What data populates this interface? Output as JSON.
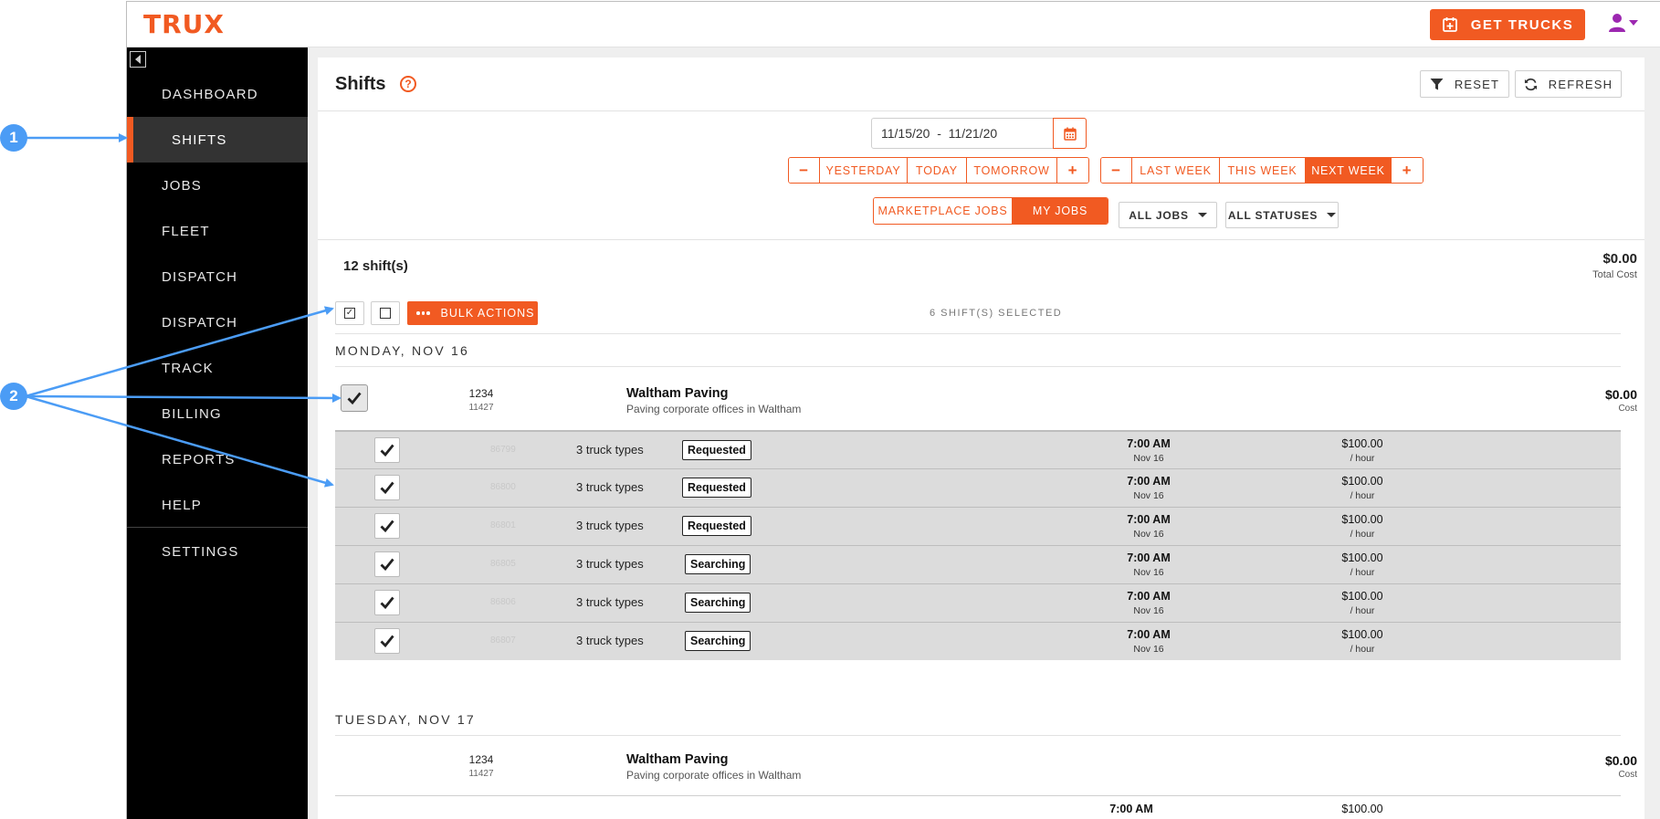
{
  "app": {
    "logo": "TRUX",
    "get_trucks_label": "GET TRUCKS"
  },
  "sidebar": {
    "items": [
      {
        "label": "DASHBOARD",
        "active": false
      },
      {
        "label": "SHIFTS",
        "active": true
      },
      {
        "label": "JOBS",
        "active": false
      },
      {
        "label": "FLEET",
        "active": false
      },
      {
        "label": "DISPATCH",
        "active": false
      },
      {
        "label": "DISPATCH",
        "active": false
      },
      {
        "label": "TRACK",
        "active": false
      },
      {
        "label": "BILLING",
        "active": false
      },
      {
        "label": "REPORTS",
        "active": false
      },
      {
        "label": "HELP",
        "active": false
      },
      {
        "label": "SETTINGS",
        "active": false
      }
    ]
  },
  "page": {
    "title": "Shifts",
    "reset_label": "RESET",
    "refresh_label": "REFRESH"
  },
  "date_filter": {
    "range": "11/15/20  -  11/21/20",
    "day_buttons": [
      "−",
      "YESTERDAY",
      "TODAY",
      "TOMORROW",
      "+"
    ],
    "week_buttons": [
      "−",
      "LAST WEEK",
      "THIS WEEK",
      "NEXT WEEK",
      "+"
    ],
    "selected_week": "NEXT WEEK"
  },
  "job_source": {
    "options": [
      "MARKETPLACE JOBS",
      "MY JOBS"
    ],
    "selected": "MY JOBS"
  },
  "filters": {
    "jobs": "ALL JOBS",
    "statuses": "ALL STATUSES"
  },
  "summary": {
    "shift_count": "12 shift(s)",
    "total_cost": "$0.00",
    "total_cost_label": "Total Cost"
  },
  "bulk": {
    "label": "BULK ACTIONS",
    "selected_text": "6 SHIFT(S) SELECTED"
  },
  "days": [
    {
      "heading": "MONDAY, NOV 16",
      "job": {
        "id": "1234",
        "sub_id": "11427",
        "name": "Waltham Paving",
        "description": "Paving corporate offices in Waltham",
        "cost": "$0.00",
        "cost_label": "Cost"
      },
      "shifts": [
        {
          "id": "86799",
          "trucks": "3 truck types",
          "status": "Requested",
          "time": "7:00 AM",
          "date": "Nov 16",
          "rate": "$100.00",
          "per": "/ hour"
        },
        {
          "id": "86800",
          "trucks": "3 truck types",
          "status": "Requested",
          "time": "7:00 AM",
          "date": "Nov 16",
          "rate": "$100.00",
          "per": "/ hour"
        },
        {
          "id": "86801",
          "trucks": "3 truck types",
          "status": "Requested",
          "time": "7:00 AM",
          "date": "Nov 16",
          "rate": "$100.00",
          "per": "/ hour"
        },
        {
          "id": "86805",
          "trucks": "3 truck types",
          "status": "Searching",
          "time": "7:00 AM",
          "date": "Nov 16",
          "rate": "$100.00",
          "per": "/ hour"
        },
        {
          "id": "86806",
          "trucks": "3 truck types",
          "status": "Searching",
          "time": "7:00 AM",
          "date": "Nov 16",
          "rate": "$100.00",
          "per": "/ hour"
        },
        {
          "id": "86807",
          "trucks": "3 truck types",
          "status": "Searching",
          "time": "7:00 AM",
          "date": "Nov 16",
          "rate": "$100.00",
          "per": "/ hour"
        }
      ]
    },
    {
      "heading": "TUESDAY, NOV 17",
      "job": {
        "id": "1234",
        "sub_id": "11427",
        "name": "Waltham Paving",
        "description": "Paving corporate offices in Waltham",
        "cost": "$0.00",
        "cost_label": "Cost"
      },
      "partial_shift": {
        "time": "7:00 AM",
        "rate": "$100.00"
      }
    }
  ],
  "annotations": {
    "badges": [
      "1",
      "2"
    ],
    "color": "#4b9cf5"
  },
  "colors": {
    "accent": "#f15a22",
    "sidebar_bg": "#000000",
    "active_item_bg": "#333333",
    "shift_row_bg": "#dcdcdc",
    "user_icon": "#9c27b0"
  }
}
